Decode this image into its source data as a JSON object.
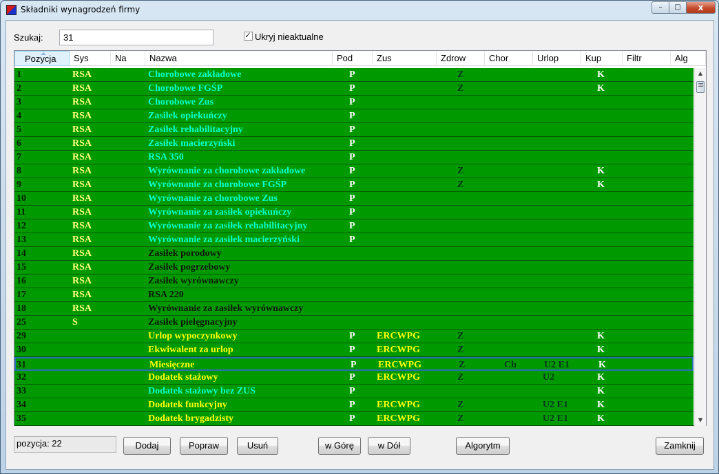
{
  "window": {
    "title": "Składniki wynagrodzeń firmy",
    "controls": {
      "minimize": "–",
      "maximize": "□",
      "close": "x"
    },
    "icon": "app-icon"
  },
  "search": {
    "label": "Szukaj:",
    "value": "31"
  },
  "filter": {
    "label": "Ukryj nieaktualne",
    "checked": true
  },
  "columns": [
    "Pozycja",
    "Sys",
    "Na",
    "Nazwa",
    "Pod",
    "Zus",
    "Zdrow",
    "Chor",
    "Urlop",
    "Kup",
    "Filtr",
    "Alg"
  ],
  "colors": {
    "grid_bg": "#009900",
    "name_cyan": "#00ffcc",
    "name_dark": "#0a1a00",
    "name_yellow": "#ffff00",
    "selection": "#2b6fb5"
  },
  "rows": [
    {
      "pos": "1",
      "sys": "RSA",
      "name": "Chorobowe zakładowe",
      "pod": "P",
      "zus": "",
      "zdrow": "Z",
      "chor": "",
      "urlop": "",
      "kup": "K",
      "color": "cyan"
    },
    {
      "pos": "2",
      "sys": "RSA",
      "name": "Chorobowe FGŚP",
      "pod": "P",
      "zus": "",
      "zdrow": "Z",
      "chor": "",
      "urlop": "",
      "kup": "K",
      "color": "cyan"
    },
    {
      "pos": "3",
      "sys": "RSA",
      "name": "Chorobowe Zus",
      "pod": "P",
      "zus": "",
      "zdrow": "",
      "chor": "",
      "urlop": "",
      "kup": "",
      "color": "cyan"
    },
    {
      "pos": "4",
      "sys": "RSA",
      "name": "Zasiłek opiekuńczy",
      "pod": "P",
      "zus": "",
      "zdrow": "",
      "chor": "",
      "urlop": "",
      "kup": "",
      "color": "cyan"
    },
    {
      "pos": "5",
      "sys": "RSA",
      "name": "Zasiłek rehabilitacyjny",
      "pod": "P",
      "zus": "",
      "zdrow": "",
      "chor": "",
      "urlop": "",
      "kup": "",
      "color": "cyan"
    },
    {
      "pos": "6",
      "sys": "RSA",
      "name": "Zasiłek macierzyński",
      "pod": "P",
      "zus": "",
      "zdrow": "",
      "chor": "",
      "urlop": "",
      "kup": "",
      "color": "cyan"
    },
    {
      "pos": "7",
      "sys": "RSA",
      "name": "RSA 350",
      "pod": "P",
      "zus": "",
      "zdrow": "",
      "chor": "",
      "urlop": "",
      "kup": "",
      "color": "cyan"
    },
    {
      "pos": "8",
      "sys": "RSA",
      "name": "Wyrównanie za chorobowe zakładowe",
      "pod": "P",
      "zus": "",
      "zdrow": "Z",
      "chor": "",
      "urlop": "",
      "kup": "K",
      "color": "cyan"
    },
    {
      "pos": "9",
      "sys": "RSA",
      "name": "Wyrównanie za chorobowe FGŚP",
      "pod": "P",
      "zus": "",
      "zdrow": "Z",
      "chor": "",
      "urlop": "",
      "kup": "K",
      "color": "cyan"
    },
    {
      "pos": "10",
      "sys": "RSA",
      "name": "Wyrównanie za chorobowe Zus",
      "pod": "P",
      "zus": "",
      "zdrow": "",
      "chor": "",
      "urlop": "",
      "kup": "",
      "color": "cyan"
    },
    {
      "pos": "11",
      "sys": "RSA",
      "name": "Wyrównanie za zasiłek opiekuńczy",
      "pod": "P",
      "zus": "",
      "zdrow": "",
      "chor": "",
      "urlop": "",
      "kup": "",
      "color": "cyan"
    },
    {
      "pos": "12",
      "sys": "RSA",
      "name": "Wyrównanie za zasiłek rehabilitacyjny",
      "pod": "P",
      "zus": "",
      "zdrow": "",
      "chor": "",
      "urlop": "",
      "kup": "",
      "color": "cyan"
    },
    {
      "pos": "13",
      "sys": "RSA",
      "name": "Wyrównanie za zasiłek macierzyński",
      "pod": "P",
      "zus": "",
      "zdrow": "",
      "chor": "",
      "urlop": "",
      "kup": "",
      "color": "cyan"
    },
    {
      "pos": "14",
      "sys": "RSA",
      "name": "Zasiłek porodowy",
      "pod": "",
      "zus": "",
      "zdrow": "",
      "chor": "",
      "urlop": "",
      "kup": "",
      "color": "dark"
    },
    {
      "pos": "15",
      "sys": "RSA",
      "name": "Zasiłek pogrzebowy",
      "pod": "",
      "zus": "",
      "zdrow": "",
      "chor": "",
      "urlop": "",
      "kup": "",
      "color": "dark"
    },
    {
      "pos": "16",
      "sys": "RSA",
      "name": "Zasiłek wyrównawczy",
      "pod": "",
      "zus": "",
      "zdrow": "",
      "chor": "",
      "urlop": "",
      "kup": "",
      "color": "dark"
    },
    {
      "pos": "17",
      "sys": "RSA",
      "name": "RSA 220",
      "pod": "",
      "zus": "",
      "zdrow": "",
      "chor": "",
      "urlop": "",
      "kup": "",
      "color": "dark"
    },
    {
      "pos": "18",
      "sys": "RSA",
      "name": "Wyrównanie za zasiłek wyrównawczy",
      "pod": "",
      "zus": "",
      "zdrow": "",
      "chor": "",
      "urlop": "",
      "kup": "",
      "color": "dark"
    },
    {
      "pos": "25",
      "sys": "S",
      "name": "Zasiłek pielęgnacyjny",
      "pod": "",
      "zus": "",
      "zdrow": "",
      "chor": "",
      "urlop": "",
      "kup": "",
      "color": "dark"
    },
    {
      "pos": "29",
      "sys": "",
      "name": "Urlop wypoczynkowy",
      "pod": "P",
      "zus": "ERCWPG",
      "zdrow": "Z",
      "chor": "",
      "urlop": "",
      "kup": "K",
      "color": "yellow"
    },
    {
      "pos": "30",
      "sys": "",
      "name": "Ekwiwalent za urlop",
      "pod": "P",
      "zus": "ERCWPG",
      "zdrow": "Z",
      "chor": "",
      "urlop": "",
      "kup": "K",
      "color": "yellow"
    },
    {
      "pos": "31",
      "sys": "",
      "name": "Miesięczne",
      "pod": "P",
      "zus": "ERCWPG",
      "zdrow": "Z",
      "chor": "Ch",
      "urlop": "U2 E1",
      "kup": "K",
      "color": "yellow",
      "selected": true
    },
    {
      "pos": "32",
      "sys": "",
      "name": "Dodatek stażowy",
      "pod": "P",
      "zus": "ERCWPG",
      "zdrow": "Z",
      "chor": "",
      "urlop": "U2",
      "kup": "K",
      "color": "yellow"
    },
    {
      "pos": "33",
      "sys": "",
      "name": "Dodatek stażowy bez ZUS",
      "pod": "P",
      "zus": "",
      "zdrow": "",
      "chor": "",
      "urlop": "",
      "kup": "K",
      "color": "cyan"
    },
    {
      "pos": "34",
      "sys": "",
      "name": "Dodatek funkcyjny",
      "pod": "P",
      "zus": "ERCWPG",
      "zdrow": "Z",
      "chor": "",
      "urlop": "U2 E1",
      "kup": "K",
      "color": "yellow"
    },
    {
      "pos": "35",
      "sys": "",
      "name": "Dodatek brygadzisty",
      "pod": "P",
      "zus": "ERCWPG",
      "zdrow": "Z",
      "chor": "",
      "urlop": "U2 E1",
      "kup": "K",
      "color": "yellow"
    }
  ],
  "status": {
    "text": "pozycja:  22"
  },
  "buttons": {
    "add": "Dodaj",
    "edit": "Popraw",
    "delete": "Usuń",
    "up": "w Górę",
    "down": "w Dół",
    "algorithm": "Algorytm",
    "close": "Zamknij"
  }
}
